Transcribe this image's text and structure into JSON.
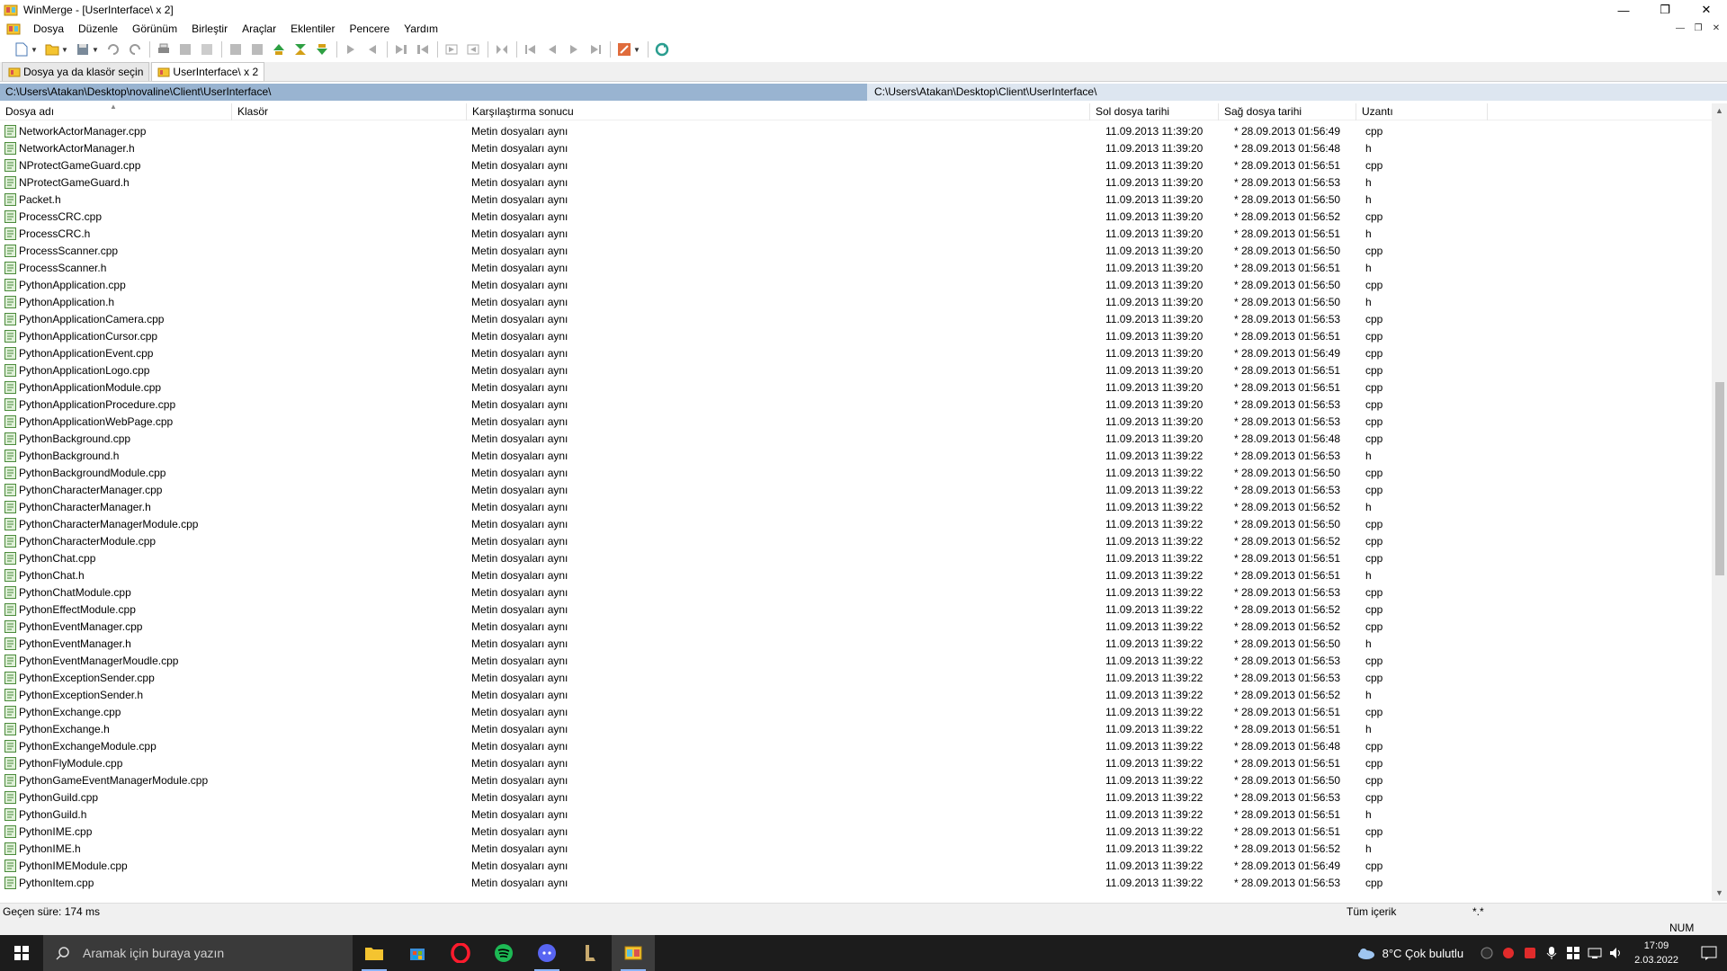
{
  "window": {
    "title": "WinMerge - [UserInterface\\ x 2]"
  },
  "menu": [
    "Dosya",
    "Düzenle",
    "Görünüm",
    "Birleştir",
    "Araçlar",
    "Eklentiler",
    "Pencere",
    "Yardım"
  ],
  "tabs": [
    {
      "label": "Dosya ya da klasör seçin",
      "active": false
    },
    {
      "label": "UserInterface\\ x 2",
      "active": true
    }
  ],
  "paths": {
    "left": "C:\\Users\\Atakan\\Desktop\\novaline\\Client\\UserInterface\\",
    "right": "C:\\Users\\Atakan\\Desktop\\Client\\UserInterface\\"
  },
  "columns": {
    "name": "Dosya adı",
    "folder": "Klasör",
    "result": "Karşılaştırma sonucu",
    "left_date": "Sol dosya tarihi",
    "right_date": "Sağ dosya tarihi",
    "ext": "Uzantı"
  },
  "rows": [
    {
      "name": "NetworkActorManager.cpp",
      "result": "Metin dosyaları aynı",
      "left": "11.09.2013 11:39:20",
      "right": "* 28.09.2013 01:56:49",
      "ext": "cpp"
    },
    {
      "name": "NetworkActorManager.h",
      "result": "Metin dosyaları aynı",
      "left": "11.09.2013 11:39:20",
      "right": "* 28.09.2013 01:56:48",
      "ext": "h"
    },
    {
      "name": "NProtectGameGuard.cpp",
      "result": "Metin dosyaları aynı",
      "left": "11.09.2013 11:39:20",
      "right": "* 28.09.2013 01:56:51",
      "ext": "cpp"
    },
    {
      "name": "NProtectGameGuard.h",
      "result": "Metin dosyaları aynı",
      "left": "11.09.2013 11:39:20",
      "right": "* 28.09.2013 01:56:53",
      "ext": "h"
    },
    {
      "name": "Packet.h",
      "result": "Metin dosyaları aynı",
      "left": "11.09.2013 11:39:20",
      "right": "* 28.09.2013 01:56:50",
      "ext": "h"
    },
    {
      "name": "ProcessCRC.cpp",
      "result": "Metin dosyaları aynı",
      "left": "11.09.2013 11:39:20",
      "right": "* 28.09.2013 01:56:52",
      "ext": "cpp"
    },
    {
      "name": "ProcessCRC.h",
      "result": "Metin dosyaları aynı",
      "left": "11.09.2013 11:39:20",
      "right": "* 28.09.2013 01:56:51",
      "ext": "h"
    },
    {
      "name": "ProcessScanner.cpp",
      "result": "Metin dosyaları aynı",
      "left": "11.09.2013 11:39:20",
      "right": "* 28.09.2013 01:56:50",
      "ext": "cpp"
    },
    {
      "name": "ProcessScanner.h",
      "result": "Metin dosyaları aynı",
      "left": "11.09.2013 11:39:20",
      "right": "* 28.09.2013 01:56:51",
      "ext": "h"
    },
    {
      "name": "PythonApplication.cpp",
      "result": "Metin dosyaları aynı",
      "left": "11.09.2013 11:39:20",
      "right": "* 28.09.2013 01:56:50",
      "ext": "cpp"
    },
    {
      "name": "PythonApplication.h",
      "result": "Metin dosyaları aynı",
      "left": "11.09.2013 11:39:20",
      "right": "* 28.09.2013 01:56:50",
      "ext": "h"
    },
    {
      "name": "PythonApplicationCamera.cpp",
      "result": "Metin dosyaları aynı",
      "left": "11.09.2013 11:39:20",
      "right": "* 28.09.2013 01:56:53",
      "ext": "cpp"
    },
    {
      "name": "PythonApplicationCursor.cpp",
      "result": "Metin dosyaları aynı",
      "left": "11.09.2013 11:39:20",
      "right": "* 28.09.2013 01:56:51",
      "ext": "cpp"
    },
    {
      "name": "PythonApplicationEvent.cpp",
      "result": "Metin dosyaları aynı",
      "left": "11.09.2013 11:39:20",
      "right": "* 28.09.2013 01:56:49",
      "ext": "cpp"
    },
    {
      "name": "PythonApplicationLogo.cpp",
      "result": "Metin dosyaları aynı",
      "left": "11.09.2013 11:39:20",
      "right": "* 28.09.2013 01:56:51",
      "ext": "cpp"
    },
    {
      "name": "PythonApplicationModule.cpp",
      "result": "Metin dosyaları aynı",
      "left": "11.09.2013 11:39:20",
      "right": "* 28.09.2013 01:56:51",
      "ext": "cpp"
    },
    {
      "name": "PythonApplicationProcedure.cpp",
      "result": "Metin dosyaları aynı",
      "left": "11.09.2013 11:39:20",
      "right": "* 28.09.2013 01:56:53",
      "ext": "cpp"
    },
    {
      "name": "PythonApplicationWebPage.cpp",
      "result": "Metin dosyaları aynı",
      "left": "11.09.2013 11:39:20",
      "right": "* 28.09.2013 01:56:53",
      "ext": "cpp"
    },
    {
      "name": "PythonBackground.cpp",
      "result": "Metin dosyaları aynı",
      "left": "11.09.2013 11:39:20",
      "right": "* 28.09.2013 01:56:48",
      "ext": "cpp"
    },
    {
      "name": "PythonBackground.h",
      "result": "Metin dosyaları aynı",
      "left": "11.09.2013 11:39:22",
      "right": "* 28.09.2013 01:56:53",
      "ext": "h"
    },
    {
      "name": "PythonBackgroundModule.cpp",
      "result": "Metin dosyaları aynı",
      "left": "11.09.2013 11:39:22",
      "right": "* 28.09.2013 01:56:50",
      "ext": "cpp"
    },
    {
      "name": "PythonCharacterManager.cpp",
      "result": "Metin dosyaları aynı",
      "left": "11.09.2013 11:39:22",
      "right": "* 28.09.2013 01:56:53",
      "ext": "cpp"
    },
    {
      "name": "PythonCharacterManager.h",
      "result": "Metin dosyaları aynı",
      "left": "11.09.2013 11:39:22",
      "right": "* 28.09.2013 01:56:52",
      "ext": "h"
    },
    {
      "name": "PythonCharacterManagerModule.cpp",
      "result": "Metin dosyaları aynı",
      "left": "11.09.2013 11:39:22",
      "right": "* 28.09.2013 01:56:50",
      "ext": "cpp"
    },
    {
      "name": "PythonCharacterModule.cpp",
      "result": "Metin dosyaları aynı",
      "left": "11.09.2013 11:39:22",
      "right": "* 28.09.2013 01:56:52",
      "ext": "cpp"
    },
    {
      "name": "PythonChat.cpp",
      "result": "Metin dosyaları aynı",
      "left": "11.09.2013 11:39:22",
      "right": "* 28.09.2013 01:56:51",
      "ext": "cpp"
    },
    {
      "name": "PythonChat.h",
      "result": "Metin dosyaları aynı",
      "left": "11.09.2013 11:39:22",
      "right": "* 28.09.2013 01:56:51",
      "ext": "h"
    },
    {
      "name": "PythonChatModule.cpp",
      "result": "Metin dosyaları aynı",
      "left": "11.09.2013 11:39:22",
      "right": "* 28.09.2013 01:56:53",
      "ext": "cpp"
    },
    {
      "name": "PythonEffectModule.cpp",
      "result": "Metin dosyaları aynı",
      "left": "11.09.2013 11:39:22",
      "right": "* 28.09.2013 01:56:52",
      "ext": "cpp"
    },
    {
      "name": "PythonEventManager.cpp",
      "result": "Metin dosyaları aynı",
      "left": "11.09.2013 11:39:22",
      "right": "* 28.09.2013 01:56:52",
      "ext": "cpp"
    },
    {
      "name": "PythonEventManager.h",
      "result": "Metin dosyaları aynı",
      "left": "11.09.2013 11:39:22",
      "right": "* 28.09.2013 01:56:50",
      "ext": "h"
    },
    {
      "name": "PythonEventManagerMoudle.cpp",
      "result": "Metin dosyaları aynı",
      "left": "11.09.2013 11:39:22",
      "right": "* 28.09.2013 01:56:53",
      "ext": "cpp"
    },
    {
      "name": "PythonExceptionSender.cpp",
      "result": "Metin dosyaları aynı",
      "left": "11.09.2013 11:39:22",
      "right": "* 28.09.2013 01:56:53",
      "ext": "cpp"
    },
    {
      "name": "PythonExceptionSender.h",
      "result": "Metin dosyaları aynı",
      "left": "11.09.2013 11:39:22",
      "right": "* 28.09.2013 01:56:52",
      "ext": "h"
    },
    {
      "name": "PythonExchange.cpp",
      "result": "Metin dosyaları aynı",
      "left": "11.09.2013 11:39:22",
      "right": "* 28.09.2013 01:56:51",
      "ext": "cpp"
    },
    {
      "name": "PythonExchange.h",
      "result": "Metin dosyaları aynı",
      "left": "11.09.2013 11:39:22",
      "right": "* 28.09.2013 01:56:51",
      "ext": "h"
    },
    {
      "name": "PythonExchangeModule.cpp",
      "result": "Metin dosyaları aynı",
      "left": "11.09.2013 11:39:22",
      "right": "* 28.09.2013 01:56:48",
      "ext": "cpp"
    },
    {
      "name": "PythonFlyModule.cpp",
      "result": "Metin dosyaları aynı",
      "left": "11.09.2013 11:39:22",
      "right": "* 28.09.2013 01:56:51",
      "ext": "cpp"
    },
    {
      "name": "PythonGameEventManagerModule.cpp",
      "result": "Metin dosyaları aynı",
      "left": "11.09.2013 11:39:22",
      "right": "* 28.09.2013 01:56:50",
      "ext": "cpp"
    },
    {
      "name": "PythonGuild.cpp",
      "result": "Metin dosyaları aynı",
      "left": "11.09.2013 11:39:22",
      "right": "* 28.09.2013 01:56:53",
      "ext": "cpp"
    },
    {
      "name": "PythonGuild.h",
      "result": "Metin dosyaları aynı",
      "left": "11.09.2013 11:39:22",
      "right": "* 28.09.2013 01:56:51",
      "ext": "h"
    },
    {
      "name": "PythonIME.cpp",
      "result": "Metin dosyaları aynı",
      "left": "11.09.2013 11:39:22",
      "right": "* 28.09.2013 01:56:51",
      "ext": "cpp"
    },
    {
      "name": "PythonIME.h",
      "result": "Metin dosyaları aynı",
      "left": "11.09.2013 11:39:22",
      "right": "* 28.09.2013 01:56:52",
      "ext": "h"
    },
    {
      "name": "PythonIMEModule.cpp",
      "result": "Metin dosyaları aynı",
      "left": "11.09.2013 11:39:22",
      "right": "* 28.09.2013 01:56:49",
      "ext": "cpp"
    },
    {
      "name": "PythonItem.cpp",
      "result": "Metin dosyaları aynı",
      "left": "11.09.2013 11:39:22",
      "right": "* 28.09.2013 01:56:53",
      "ext": "cpp"
    }
  ],
  "status": {
    "elapsed": "Geçen süre: 174 ms",
    "filter": "Tüm içerik",
    "mask": "*.*",
    "num": "NUM"
  },
  "taskbar": {
    "search_placeholder": "Aramak için buraya yazın",
    "weather": "8°C  Çok bulutlu",
    "time": "17:09",
    "date": "2.03.2022"
  },
  "colors": {
    "path_left_bg": "#99b4d1",
    "path_right_bg": "#dde6f0",
    "taskbar_bg": "#1c1c1c"
  }
}
